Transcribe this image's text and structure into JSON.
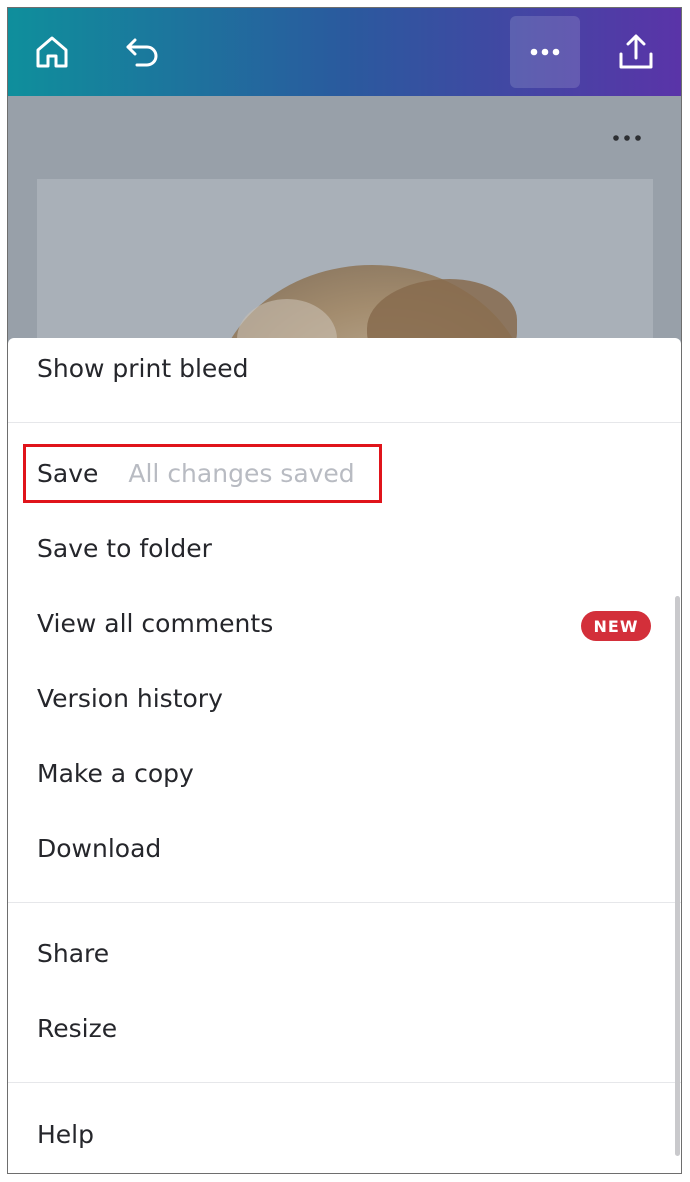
{
  "icons": {
    "home": "home-icon",
    "undo": "undo-icon",
    "more": "more-horizontal-icon",
    "share": "share-upload-icon"
  },
  "colors": {
    "topbar_start": "#0f8f9c",
    "topbar_end": "#5a34a8",
    "highlight": "#e0141b",
    "badge": "#d32f3a"
  },
  "menu": {
    "show_print_bleed": "Show print bleed",
    "save": "Save",
    "save_status": "All changes saved",
    "save_to_folder": "Save to folder",
    "view_all_comments": "View all comments",
    "new_badge": "NEW",
    "version_history": "Version history",
    "make_a_copy": "Make a copy",
    "download": "Download",
    "share": "Share",
    "resize": "Resize",
    "help": "Help"
  }
}
